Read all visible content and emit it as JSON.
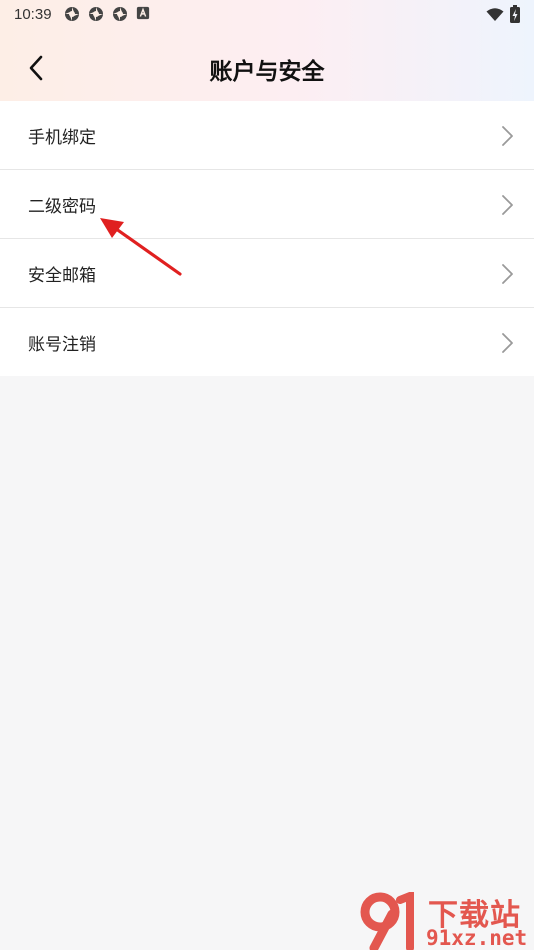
{
  "status_bar": {
    "time": "10:39",
    "left_icons": [
      "app-notification-icon",
      "app-notification-icon",
      "app-notification-icon",
      "keyboard-a-icon"
    ],
    "right_icons": [
      "wifi-icon",
      "battery-charging-icon"
    ]
  },
  "header": {
    "back_icon": "chevron-left-icon",
    "title": "账户与安全"
  },
  "menu": {
    "items": [
      {
        "label": "手机绑定",
        "icon": "chevron-right-icon"
      },
      {
        "label": "二级密码",
        "icon": "chevron-right-icon"
      },
      {
        "label": "安全邮箱",
        "icon": "chevron-right-icon"
      },
      {
        "label": "账号注销",
        "icon": "chevron-right-icon"
      }
    ]
  },
  "annotation": {
    "icon": "red-arrow-icon",
    "color": "#e02020"
  },
  "watermark": {
    "title": "下载站",
    "url": "91xz.net",
    "color": "#e3574f"
  },
  "colors": {
    "background": "#f6f6f7",
    "card": "#ffffff",
    "divider": "#e6e6e6"
  }
}
